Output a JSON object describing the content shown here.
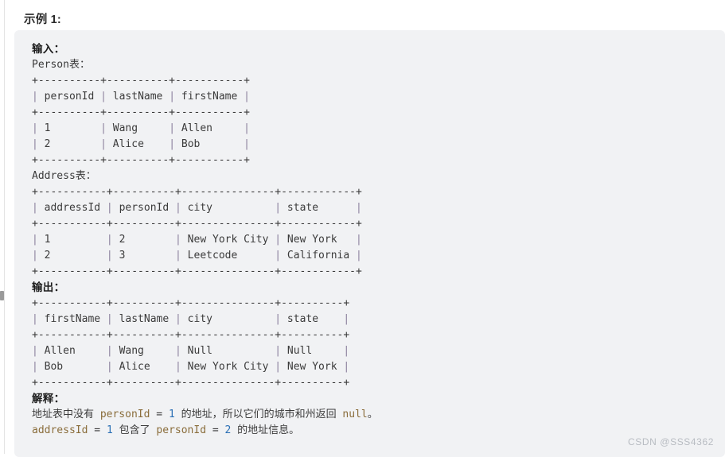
{
  "heading": "示例 1:",
  "watermark": "CSDN @SSS4362",
  "colors": {
    "page_bg": "#ffffff",
    "code_bg": "#f1f2f4",
    "text": "#3b3b3b",
    "heading": "#2b2b2b",
    "pipe": "#8a7f9c",
    "identifier": "#8a6d3b",
    "number": "#2a6fb5",
    "watermark": "#b8bcc2"
  },
  "sections": {
    "input_label": "输入：",
    "person_caption": "Person表：",
    "address_caption": "Address表：",
    "output_label": "输出：",
    "explain_label": "解释："
  },
  "person_table": {
    "separator": "+----------+----------+-----------+",
    "header": "| personId | lastName | firstName |",
    "rows": [
      "| 1        | Wang     | Allen     |",
      "| 2        | Alice    | Bob       |"
    ]
  },
  "address_table": {
    "separator": "+-----------+----------+---------------+------------+",
    "header": "| addressId | personId | city          | state      |",
    "rows": [
      "| 1         | 2        | New York City | New York   |",
      "| 2         | 3        | Leetcode      | California |"
    ]
  },
  "output_table": {
    "separator": "+-----------+----------+---------------+----------+",
    "header": "| firstName | lastName | city          | state    |",
    "rows": [
      "| Allen     | Wang     | Null          | Null     |",
      "| Bob       | Alice    | New York City | New York |"
    ]
  },
  "explanation": {
    "line1_a": "地址表中没有 ",
    "line1_ident": "personId",
    "line1_b": " = ",
    "line1_num": "1",
    "line1_c": " 的地址，所以它们的城市和州返回 ",
    "line1_null": "null",
    "line1_d": "。",
    "line2_ident1": "addressId",
    "line2_a": " = ",
    "line2_num1": "1",
    "line2_b": " 包含了 ",
    "line2_ident2": "personId",
    "line2_c": " = ",
    "line2_num2": "2",
    "line2_d": " 的地址信息。"
  }
}
